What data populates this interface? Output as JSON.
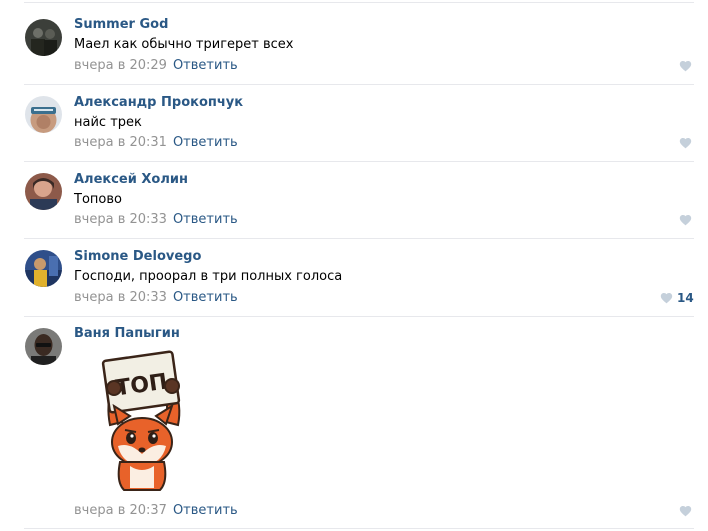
{
  "comments": [
    {
      "author": "Summer God",
      "text": "Маел как обычно тригерет всех",
      "time": "вчера в 20:29",
      "reply_label": "Ответить",
      "likes": ""
    },
    {
      "author": "Александр Прокопчук",
      "text": "найс трек",
      "time": "вчера в 20:31",
      "reply_label": "Ответить",
      "likes": ""
    },
    {
      "author": "Алексей Холин",
      "text": "Топово",
      "time": "вчера в 20:33",
      "reply_label": "Ответить",
      "likes": ""
    },
    {
      "author": "Simone Delovego",
      "text": "Господи, проорал в три полных голоса",
      "time": "вчера в 20:33",
      "reply_label": "Ответить",
      "likes": "14"
    },
    {
      "author": "Ваня Папыгин",
      "text": "",
      "time": "вчера в 20:37",
      "reply_label": "Ответить",
      "likes": ""
    }
  ],
  "sticker": {
    "sign_text": "ТОП"
  },
  "colors": {
    "link": "#2a5885",
    "muted": "#939393",
    "divider": "#e7e8ec",
    "like_icon": "#c5d0db"
  }
}
